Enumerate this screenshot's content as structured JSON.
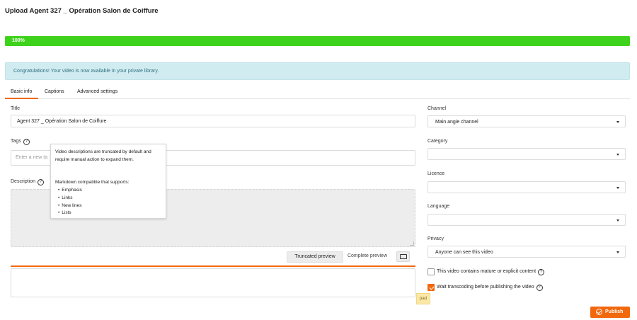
{
  "page": {
    "title": "Upload Agent 327 _ Opération Salon de Coiffure"
  },
  "progress": {
    "label": "100%",
    "value": 1.0
  },
  "alert": {
    "text": "Congratulations! Your video is now available in your private library."
  },
  "tabs": [
    {
      "label": "Basic info",
      "active": true
    },
    {
      "label": "Captions",
      "active": false
    },
    {
      "label": "Advanced settings",
      "active": false
    }
  ],
  "form": {
    "title_label": "Title",
    "title_value": "Agent 327 _ Opération Salon de Coiffure",
    "tags_label": "Tags",
    "tags_placeholder": "Enter a new ta",
    "description_label": "Description",
    "description_value": ""
  },
  "tooltip": {
    "line1": "Video descriptions are truncated by default and",
    "line2": "require manual action to expand them.",
    "line3": "Markdown compatible that supports:",
    "items": [
      "Emphasis",
      "Links",
      "New lines",
      "Lists"
    ]
  },
  "preview": {
    "truncated_label": "Truncated preview",
    "complete_label": "Complete preview"
  },
  "pad_label": "pad",
  "sidebar": {
    "channel_label": "Channel",
    "channel_value": "Main angie channel",
    "category_label": "Category",
    "category_value": "",
    "licence_label": "Licence",
    "licence_value": "",
    "language_label": "Language",
    "language_value": "",
    "privacy_label": "Privacy",
    "privacy_value": "Anyone can see this video",
    "mature_label": "This video contains mature or explicit content",
    "mature_checked": false,
    "wait_label": "Wait transcoding before publishing the video",
    "wait_checked": true
  },
  "publish_label": "Publish",
  "colors": {
    "accent": "#f1680d",
    "progress": "#3fd21c",
    "alert_bg": "#d1ecf1"
  },
  "icons": [
    "help-icon",
    "fullscreen-icon",
    "chevron-down-icon",
    "check-icon",
    "publish-check-icon"
  ]
}
